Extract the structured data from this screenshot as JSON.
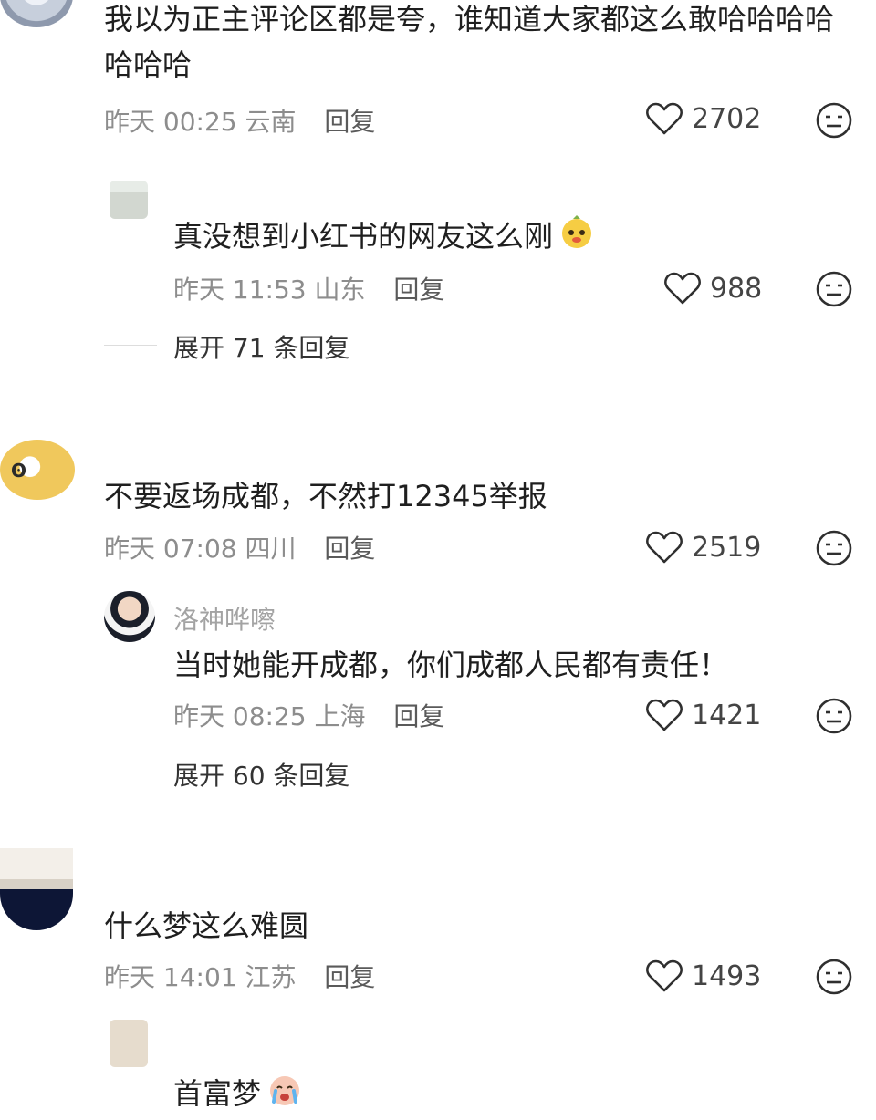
{
  "comments": [
    {
      "text_line1": "我以为正主评论区都是夸，谁知道大家都这么敢哈哈哈哈",
      "text_line2": "哈哈哈",
      "time": "昨天 00:25",
      "location": "云南",
      "reply_label": "回复",
      "likes": "2702",
      "sub": {
        "username": "",
        "text": "真没想到小红书的网友这么刚",
        "time": "昨天 11:53",
        "location": "山东",
        "reply_label": "回复",
        "likes": "988",
        "emoji_icon": "yellow-emoji-icon"
      },
      "expand_label": "展开 71 条回复"
    },
    {
      "text": "不要返场成都，不然打12345举报",
      "time": "昨天 07:08",
      "location": "四川",
      "reply_label": "回复",
      "likes": "2519",
      "sub": {
        "username": "洛神哗嚓",
        "text": "当时她能开成都，你们成都人民都有责任！",
        "time": "昨天 08:25",
        "location": "上海",
        "reply_label": "回复",
        "likes": "1421"
      },
      "expand_label": "展开 60 条回复"
    },
    {
      "text": "什么梦这么难圆",
      "time": "昨天 14:01",
      "location": "江苏",
      "reply_label": "回复",
      "likes": "1493",
      "sub": {
        "text": "首富梦",
        "emoji_icon": "crying-emoji-icon"
      }
    }
  ],
  "icons": {
    "like": "heart-icon",
    "react": "face-icon"
  },
  "colors": {
    "text": "#1f1f1f",
    "meta": "#8d8d8d",
    "icon": "#2f2f2f"
  }
}
